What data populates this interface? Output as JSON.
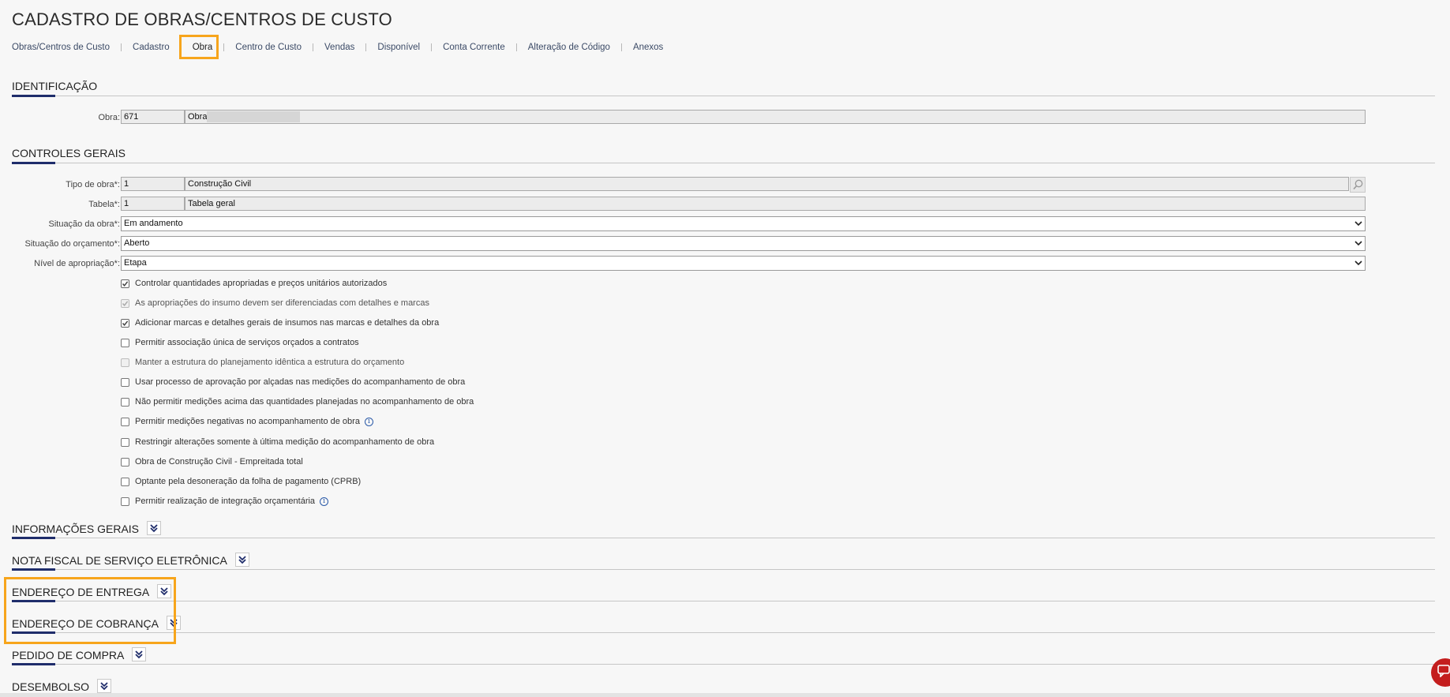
{
  "page": {
    "title": "CADASTRO DE OBRAS/CENTROS DE CUSTO"
  },
  "tabs": [
    {
      "label": "Obras/Centros de Custo"
    },
    {
      "label": "Cadastro"
    },
    {
      "label": "Obra",
      "active": true
    },
    {
      "label": "Centro de Custo"
    },
    {
      "label": "Vendas"
    },
    {
      "label": "Disponível"
    },
    {
      "label": "Conta Corrente"
    },
    {
      "label": "Alteração de Código"
    },
    {
      "label": "Anexos"
    }
  ],
  "identificacao": {
    "title": "IDENTIFICAÇÃO",
    "obra_label": "Obra:",
    "obra_code": "671",
    "obra_name": "Obra"
  },
  "controles": {
    "title": "CONTROLES GERAIS",
    "tipo_obra_label": "Tipo de obra*:",
    "tipo_obra_code": "1",
    "tipo_obra_desc": "Construção Civil",
    "tabela_label": "Tabela*:",
    "tabela_code": "1",
    "tabela_desc": "Tabela geral",
    "situacao_obra_label": "Situação da obra*:",
    "situacao_obra_value": "Em andamento",
    "situacao_orcamento_label": "Situação do orçamento*:",
    "situacao_orcamento_value": "Aberto",
    "nivel_label": "Nível de apropriação*:",
    "nivel_value": "Etapa",
    "checkboxes": [
      {
        "label": "Controlar quantidades apropriadas e preços unitários autorizados",
        "checked": true,
        "disabled": false
      },
      {
        "label": "As apropriações do insumo devem ser diferenciadas com detalhes e marcas",
        "checked": true,
        "disabled": true
      },
      {
        "label": "Adicionar marcas e detalhes gerais de insumos nas marcas e detalhes da obra",
        "checked": true,
        "disabled": false
      },
      {
        "label": "Permitir associação única de serviços orçados a contratos",
        "checked": false,
        "disabled": false
      },
      {
        "label": "Manter a estrutura do planejamento idêntica a estrutura do orçamento",
        "checked": false,
        "disabled": true
      },
      {
        "label": "Usar processo de aprovação por alçadas nas medições do acompanhamento de obra",
        "checked": false,
        "disabled": false
      },
      {
        "label": "Não permitir medições acima das quantidades planejadas no acompanhamento de obra",
        "checked": false,
        "disabled": false
      },
      {
        "label": "Permitir medições negativas no acompanhamento de obra",
        "checked": false,
        "disabled": false,
        "info": true
      },
      {
        "label": "Restringir alterações somente à última medição do acompanhamento de obra",
        "checked": false,
        "disabled": false
      },
      {
        "label": "Obra de Construção Civil - Empreitada total",
        "checked": false,
        "disabled": false
      },
      {
        "label": "Optante pela desoneração da folha de pagamento (CPRB)",
        "checked": false,
        "disabled": false
      },
      {
        "label": "Permitir realização de integração orçamentária",
        "checked": false,
        "disabled": false,
        "info": true
      }
    ]
  },
  "collapsed_sections": [
    {
      "title": "INFORMAÇÕES GERAIS"
    },
    {
      "title": "NOTA FISCAL DE SERVIÇO ELETRÔNICA"
    },
    {
      "title": "ENDEREÇO DE ENTREGA"
    },
    {
      "title": "ENDEREÇO DE COBRANÇA"
    },
    {
      "title": "PEDIDO DE COMPRA"
    },
    {
      "title": "DESEMBOLSO"
    }
  ],
  "colors": {
    "accent_bar": "#1f2d6b",
    "highlight": "#f7a51c",
    "chat_button": "#c41e1e"
  }
}
